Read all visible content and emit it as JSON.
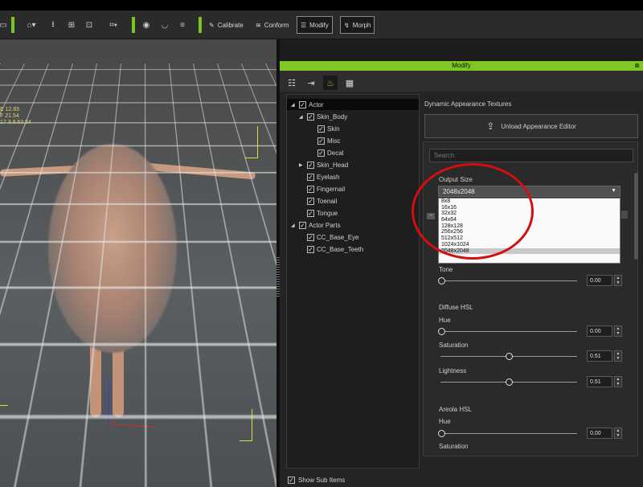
{
  "toolbar": {
    "calibrate_label": "Calibrate",
    "conform_label": "Conform",
    "modify_label": "Modify",
    "morph_label": "Morph",
    "icons": [
      "home-icon",
      "import-icon",
      "fit-icon",
      "frame-icon",
      "camera-icon",
      "eye-icon",
      "eye-mask-icon",
      "wall-icon"
    ]
  },
  "viewport": {
    "readout": [
      "E 12.65",
      "F 21.54",
      "17.3.9.63.54"
    ]
  },
  "panel": {
    "title": "Modify",
    "tabs": [
      "sliders-icon",
      "ik-icon",
      "texture-icon",
      "checker-icon"
    ],
    "close_icon": "close-icon"
  },
  "tree": {
    "items": [
      {
        "label": "Actor",
        "checked": true,
        "expanded": true
      },
      {
        "label": "Skin_Body",
        "checked": true,
        "expanded": true
      },
      {
        "label": "Skin",
        "checked": true
      },
      {
        "label": "Misc",
        "checked": true
      },
      {
        "label": "Decal",
        "checked": true
      },
      {
        "label": "Skin_Head",
        "checked": true,
        "expanded": false
      },
      {
        "label": "Eyelash",
        "checked": true
      },
      {
        "label": "Fingernail",
        "checked": true
      },
      {
        "label": "Toenail",
        "checked": true
      },
      {
        "label": "Tongue",
        "checked": true
      },
      {
        "label": "Actor Parts",
        "checked": true,
        "expanded": true
      },
      {
        "label": "CC_Base_Eye",
        "checked": true
      },
      {
        "label": "CC_Base_Teeth",
        "checked": true
      }
    ]
  },
  "editor": {
    "section_title": "Dynamic Appearance Textures",
    "unload_label": "Unload Appearance Editor",
    "search_placeholder": "Search",
    "output_size_label": "Output Size",
    "output_size_value": "2048x2048",
    "output_size_options": [
      "8x8",
      "16x16",
      "32x32",
      "64x64",
      "128x128",
      "256x256",
      "512x512",
      "1024x1024",
      "2048x2048"
    ],
    "tone_label": "Tone",
    "tone_value": "0.00",
    "diffuse_hsl_label": "Diffuse HSL",
    "hue_label": "Hue",
    "hue_value": "0.00",
    "saturation_label": "Saturation",
    "saturation_value": "0.51",
    "lightness_label": "Lightness",
    "lightness_value": "0.51",
    "areola_hsl_label": "Areola HSL",
    "areola_hue_label": "Hue",
    "areola_hue_value": "0.00",
    "areola_saturation_label": "Saturation"
  },
  "footer": {
    "show_sub_items_label": "Show Sub Items"
  },
  "colors": {
    "accent": "#7fc823",
    "highlight_ring": "#d20f10",
    "guide_yellow": "#e0dc35"
  }
}
